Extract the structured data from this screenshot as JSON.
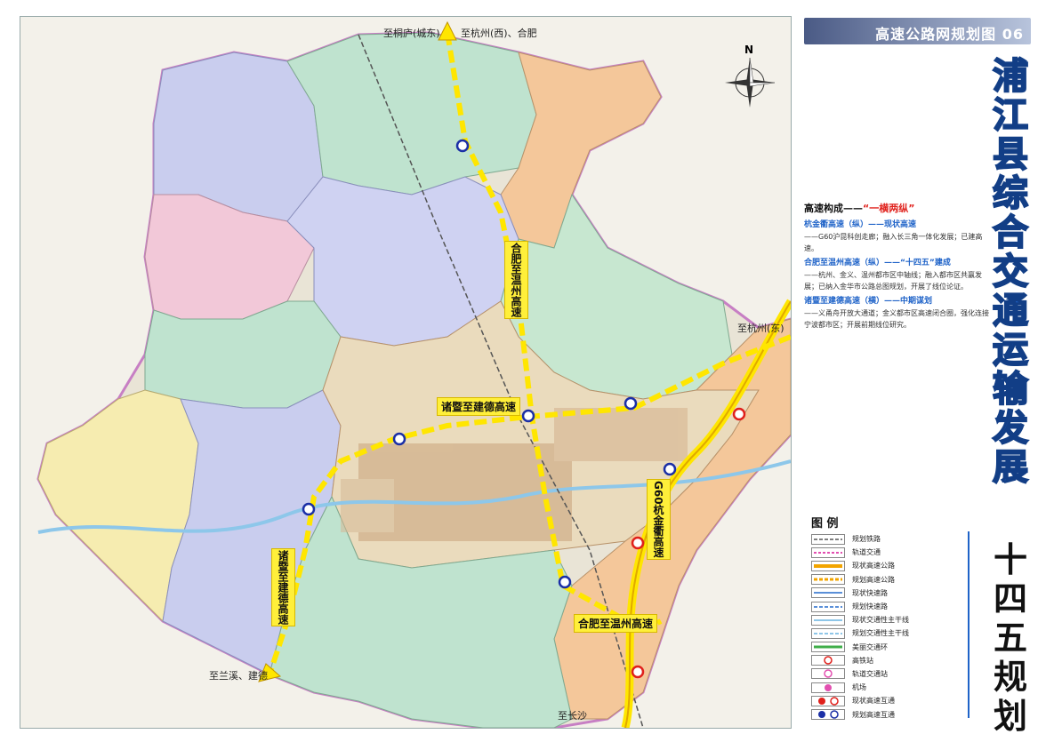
{
  "title_bar": "高速公路网规划图 06",
  "main_title": "浦江县综合交通运输发展",
  "sub_title": "十四五规划",
  "map": {
    "compass_label": "N",
    "destinations": [
      "至桐庐(城东)",
      "至杭州(西)、合肥",
      "至杭州(东)",
      "至兰溪、建德",
      "至长沙"
    ],
    "roads": {
      "hewen": "合肥至温州高速",
      "zhujian": "诸暨至建德高速",
      "zhujian_sw": "诸暨至建德高速",
      "g60": "G60杭金衢高速",
      "hewen_south": "合肥至温州高速"
    }
  },
  "description": {
    "heading": "高速构成——",
    "heading_accent": "“一横两纵”",
    "items": [
      {
        "title": "杭金衢高速（纵）——现状高速",
        "body": "——G60沪昆科创走廊；融入长三角一体化发展；已建高速。"
      },
      {
        "title": "合肥至温州高速（纵）——“十四五”建成",
        "body": "——杭州、金义、温州都市区中轴线；融入都市区共赢发展；已纳入金华市公路总图规划，开展了线位论证。"
      },
      {
        "title": "诸暨至建德高速（横）——中期谋划",
        "body": "——义甬舟开放大通道；金义都市区高速闭合圈，强化连接宁波都市区；开展前期线位研究。"
      }
    ]
  },
  "legend": {
    "title": "图 例",
    "items": [
      "规划铁路",
      "轨道交通",
      "现状高速公路",
      "规划高速公路",
      "现状快速路",
      "规划快速路",
      "现状交通性主干线",
      "规划交通性主干线",
      "美丽交通环",
      "高铁站",
      "轨道交通站",
      "机场",
      "现状高速互通",
      "规划高速互通"
    ]
  },
  "colors": {
    "accent_blue": "#1f63c8",
    "highway_yellow": "#ffe600",
    "planned_dash": "#e8a800",
    "township_orange": "#f4c79a",
    "township_blue": "#c9cdee",
    "township_green": "#bfe3cf",
    "township_yellow": "#f6ecb0"
  }
}
